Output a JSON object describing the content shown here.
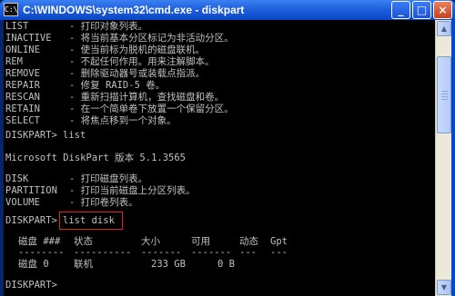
{
  "window": {
    "title": "C:\\WINDOWS\\system32\\cmd.exe - diskpart",
    "icon_label": "C:\\",
    "minimize_symbol": "_",
    "maximize_symbol": "□",
    "close_symbol": "×"
  },
  "help_commands": [
    {
      "cmd": "LIST",
      "desc": "- 打印对象列表。"
    },
    {
      "cmd": "INACTIVE",
      "desc": "- 将当前基本分区标记为非活动分区。"
    },
    {
      "cmd": "ONLINE",
      "desc": "- 使当前标为脱机的磁盘联机。"
    },
    {
      "cmd": "REM",
      "desc": "- 不起任何作用。用来注解脚本。"
    },
    {
      "cmd": "REMOVE",
      "desc": "- 删除驱动器号或装载点指派。"
    },
    {
      "cmd": "REPAIR",
      "desc": "- 修复 RAID-5 卷。"
    },
    {
      "cmd": "RESCAN",
      "desc": "- 重新扫描计算机，查找磁盘和卷。"
    },
    {
      "cmd": "RETAIN",
      "desc": "- 在一个简单卷下放置一个保留分区。"
    },
    {
      "cmd": "SELECT",
      "desc": "- 将焦点移到一个对象。"
    }
  ],
  "prompt": "DISKPART>",
  "command1": "list",
  "version_line": "Microsoft DiskPart 版本 5.1.3565",
  "list_options": [
    {
      "cmd": "DISK",
      "desc": "- 打印磁盘列表。"
    },
    {
      "cmd": "PARTITION",
      "desc": "- 打印当前磁盘上分区列表。"
    },
    {
      "cmd": "VOLUME",
      "desc": "- 打印卷列表。"
    }
  ],
  "command2": "list disk",
  "disk_table": {
    "headers": [
      "磁盘 ###",
      "状态",
      "大小",
      "可用",
      "动态",
      "Gpt"
    ],
    "separators": [
      "--------",
      "----------",
      "-------",
      "-------",
      "---",
      "---"
    ],
    "rows": [
      [
        "磁盘 0",
        "联机",
        "233 GB",
        "0 B",
        "",
        ""
      ]
    ]
  },
  "final_prompt": "DISKPART>",
  "colors": {
    "console_bg": "#000000",
    "console_fg": "#c0c0c0",
    "highlight_border": "#e02020",
    "titlebar": "#0a46c8"
  }
}
